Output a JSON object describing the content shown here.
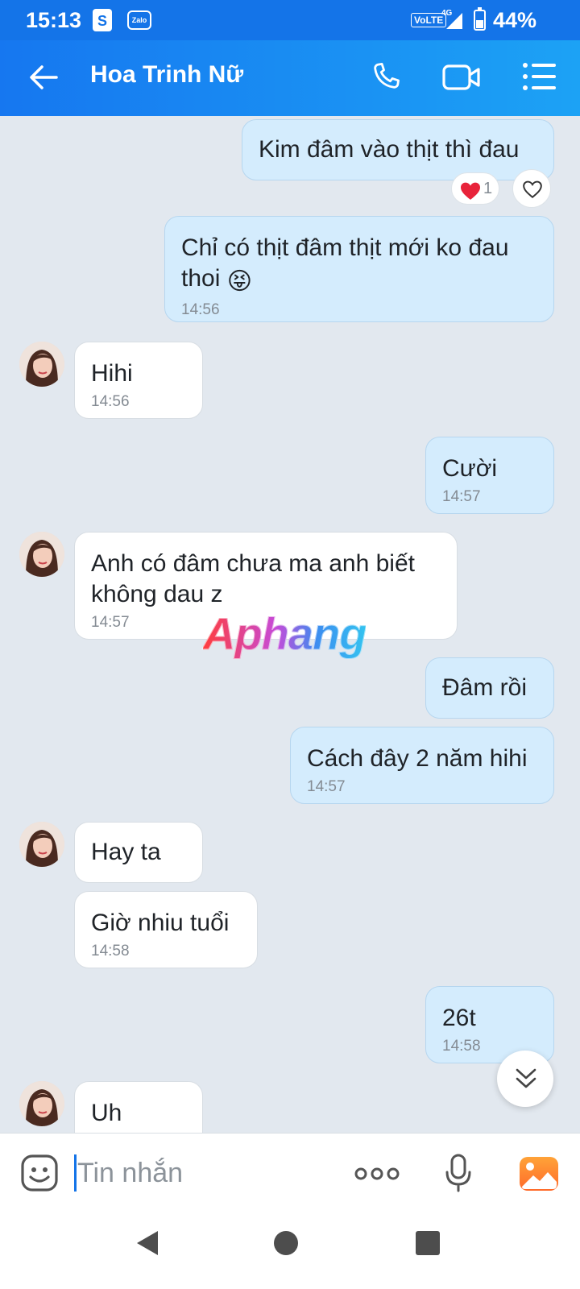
{
  "status_bar": {
    "time": "15:13",
    "zalo_label": "Zalo",
    "network": "VoLTE",
    "network_gen": "4G",
    "battery": "44%"
  },
  "header": {
    "contact_name": "Hoa Trinh Nữ"
  },
  "messages": [
    {
      "dir": "out",
      "text": "Kim đâm vào thịt thì đau",
      "reaction_count": "1"
    },
    {
      "dir": "out",
      "text": "Chỉ có thịt đâm thịt mới ko đau thoi",
      "emoji": "😝",
      "time": "14:56"
    },
    {
      "dir": "in",
      "text": "Hihi",
      "time": "14:56"
    },
    {
      "dir": "out",
      "text": "Cười",
      "time": "14:57"
    },
    {
      "dir": "in",
      "text": "Anh có đâm chưa ma anh biết không dau z",
      "time": "14:57"
    },
    {
      "dir": "out",
      "text": "Đâm rồi"
    },
    {
      "dir": "out",
      "text": "Cách đây 2 năm hihi",
      "time": "14:57"
    },
    {
      "dir": "in",
      "text": "Hay ta"
    },
    {
      "dir": "in",
      "text": "Giờ nhiu tuổi",
      "time": "14:58"
    },
    {
      "dir": "out",
      "text": "26t",
      "time": "14:58"
    },
    {
      "dir": "in",
      "text": "Uh"
    }
  ],
  "watermark": "Aphang",
  "input": {
    "placeholder": "Tin nhắn"
  },
  "colors": {
    "header_start": "#1677f0",
    "header_end": "#1ca2f5",
    "outgoing_bubble": "#d4ecfd",
    "incoming_bubble": "#ffffff",
    "chat_background": "#e2e8ef",
    "accent": "#1474e8"
  }
}
